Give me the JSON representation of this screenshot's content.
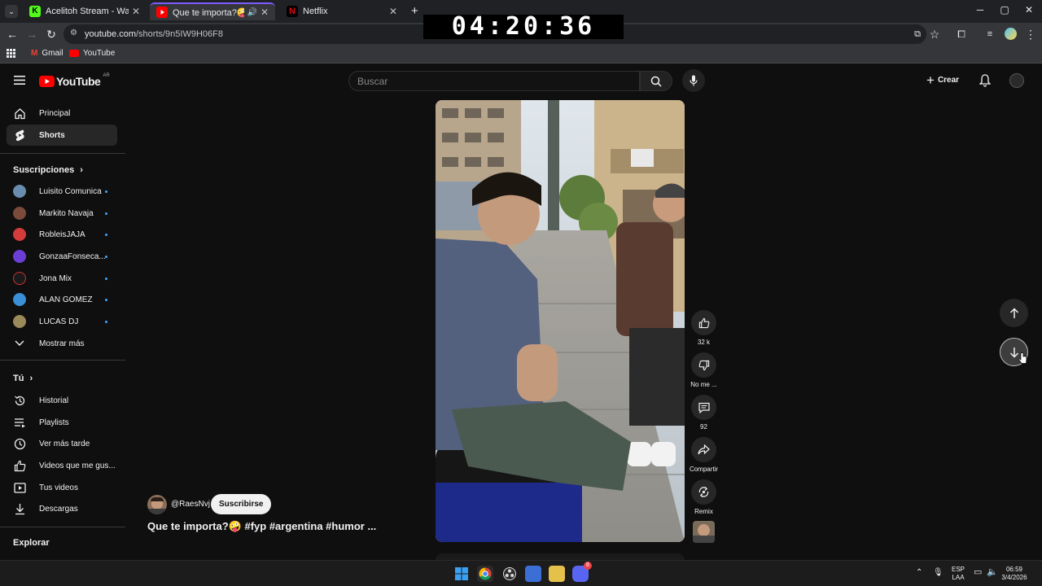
{
  "browser": {
    "tabs": [
      {
        "title": "Acelitoh Stream - Watch Live on",
        "favicon_color": "#53fc18",
        "close": "✕"
      },
      {
        "title": "Que te importa?🤪#fyp #a",
        "favicon_color": "#ff0000",
        "close": "✕"
      },
      {
        "title": "Netflix",
        "favicon_color": "#e50914",
        "close": "✕"
      }
    ],
    "new_tab": "+",
    "window_controls": {
      "minimize": "─",
      "maximize": "▢",
      "close": "✕"
    },
    "url_host": "youtube.com",
    "url_path": "/shorts/9n5IW9H06F8",
    "bookmarks": [
      {
        "label": "Gmail",
        "icon": "gmail-icon"
      },
      {
        "label": "YouTube",
        "icon": "youtube-icon"
      }
    ]
  },
  "timer": "04:20:36",
  "masthead": {
    "logo_text": "YouTube",
    "country_code": "AR",
    "search_placeholder": "Buscar",
    "create_label": "Crear"
  },
  "sidebar": {
    "main": [
      {
        "label": "Principal",
        "icon": "home-icon"
      },
      {
        "label": "Shorts",
        "icon": "shorts-icon",
        "active": true
      }
    ],
    "subscriptions_title": "Suscripciones",
    "subscriptions": [
      {
        "label": "Luisito Comunica",
        "color": "#6a8cae"
      },
      {
        "label": "Markito Navaja",
        "color": "#7a4a3a"
      },
      {
        "label": "RobleisJAJA",
        "color": "#d43b3b"
      },
      {
        "label": "GonzaaFonseca...",
        "color": "#6b3fd6"
      },
      {
        "label": "Jona Mix",
        "color": "#1a1a1a"
      },
      {
        "label": "ALAN GOMEZ",
        "color": "#3a8fd6"
      },
      {
        "label": "LUCAS DJ",
        "color": "#9a8a5a"
      }
    ],
    "show_more": "Mostrar más",
    "you_title": "Tú",
    "you_items": [
      {
        "label": "Historial",
        "icon": "history-icon"
      },
      {
        "label": "Playlists",
        "icon": "playlists-icon"
      },
      {
        "label": "Ver más tarde",
        "icon": "clock-icon"
      },
      {
        "label": "Videos que me gus...",
        "icon": "thumbs-up-icon"
      },
      {
        "label": "Tus videos",
        "icon": "play-square-icon"
      },
      {
        "label": "Descargas",
        "icon": "download-icon"
      }
    ],
    "explore_title": "Explorar"
  },
  "short": {
    "channel": "@RaesNvj",
    "subscribe_label": "Suscribirse",
    "title": "Que te importa?🤪 #fyp #argentina #humor ...",
    "actions": {
      "likes": "32 k",
      "dislike_label": "No me ...",
      "comments": "92",
      "share_label": "Compartir",
      "remix_label": "Remix"
    }
  },
  "taskbar": {
    "lang_top": "ESP",
    "lang_bottom": "LAA",
    "time": "06:59",
    "date": "3/4/2026",
    "discord_badge": "8"
  }
}
